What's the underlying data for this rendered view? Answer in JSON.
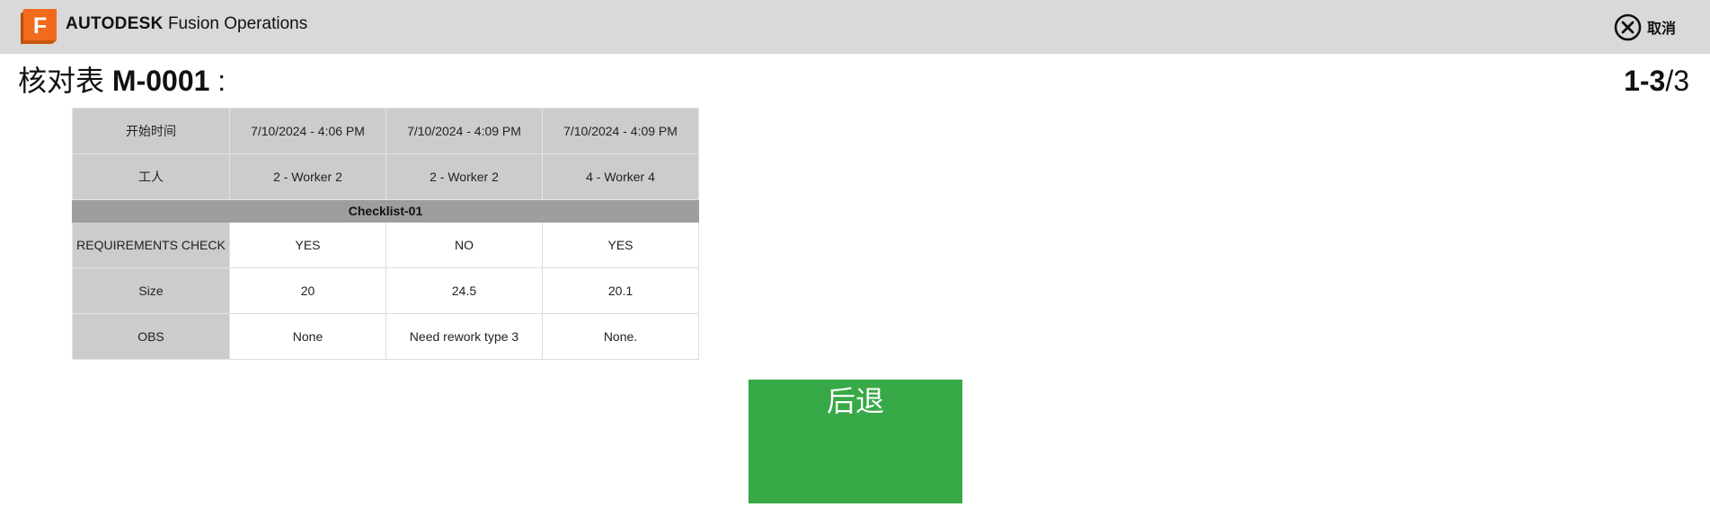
{
  "header": {
    "logo_letter": "F",
    "brand_bold": "AUTODESK",
    "brand_product": "Fusion Operations",
    "cancel_label": "取消",
    "cancel_icon": "close-circle-icon",
    "logo_color": "#f26a1b",
    "bar_color": "#d9d9d9"
  },
  "page": {
    "title_prefix": "核对表",
    "title_code": "M-0001",
    "title_suffix": " :",
    "pager_range": "1-3",
    "pager_total": "/3"
  },
  "table": {
    "header_rows": [
      {
        "label": "开始时间",
        "values": [
          "7/10/2024 - 4:06 PM",
          "7/10/2024 - 4:09 PM",
          "7/10/2024 - 4:09 PM"
        ]
      },
      {
        "label": "工人",
        "values": [
          "2 - Worker 2",
          "2 - Worker 2",
          "4 - Worker 4"
        ]
      }
    ],
    "section_title": "Checklist-01",
    "rows": [
      {
        "label": "REQUIREMENTS CHECK",
        "values": [
          "YES",
          "NO",
          "YES"
        ]
      },
      {
        "label": "Size",
        "values": [
          "20",
          "24.5",
          "20.1"
        ]
      },
      {
        "label": "OBS",
        "values": [
          "None",
          "Need rework type 3",
          "None."
        ]
      }
    ]
  },
  "actions": {
    "back_label": "后退",
    "back_color": "#37a946"
  }
}
